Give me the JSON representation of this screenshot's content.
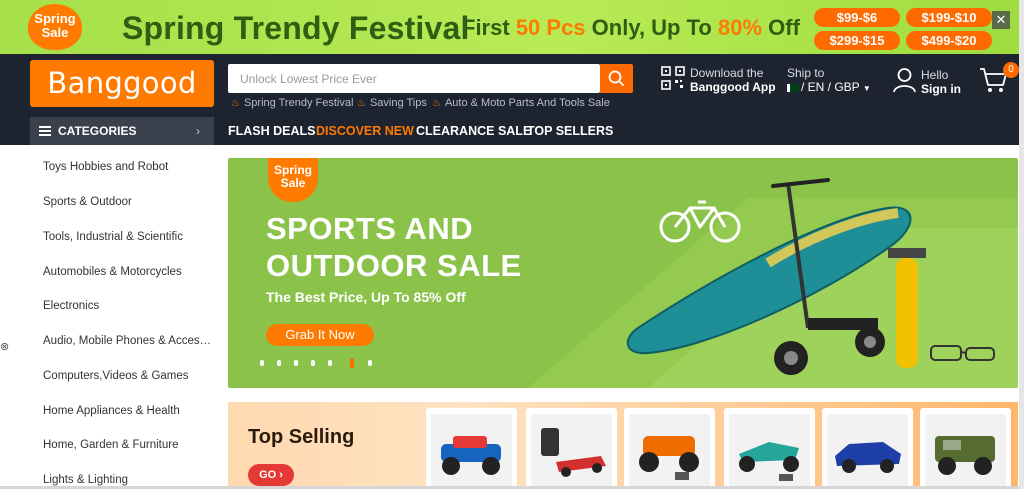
{
  "promo": {
    "sticker_line1": "Spring",
    "sticker_line2": "Sale",
    "title": "Spring Trendy Festival",
    "sub_prefix": "First",
    "sub_highlight1": "50 Pcs",
    "sub_middle": "Only, Up To",
    "sub_highlight2": "80%",
    "sub_suffix": "Off",
    "coupons": [
      "$99-$6",
      "$199-$10",
      "$299-$15",
      "$499-$20"
    ],
    "close_glyph": "✕"
  },
  "header": {
    "logo": "Banggood",
    "search_placeholder": "Unlock Lowest Price Ever",
    "hot_tags": [
      "Spring Trendy Festival",
      "Saving Tips",
      "Auto & Moto Parts And Tools Sale"
    ],
    "app_line1": "Download the",
    "app_line2": "Banggood App",
    "ship_line1": "Ship to",
    "ship_line2": "/ EN / GBP",
    "hello": "Hello",
    "sign_in": "Sign in",
    "cart_count": "0"
  },
  "nav": {
    "categories": "CATEGORIES",
    "links": [
      "FLASH DEALS",
      "DISCOVER NEW",
      "CLEARANCE SALE",
      "TOP SELLERS"
    ]
  },
  "sidebar": {
    "items": [
      "Toys Hobbies and Robot",
      "Sports & Outdoor",
      "Tools, Industrial & Scientific",
      "Automobiles & Motorcycles",
      "Electronics",
      "Audio, Mobile Phones & Accessories",
      "Computers,Videos & Games",
      "Home Appliances & Health",
      "Home, Garden & Furniture",
      "Lights & Lighting"
    ]
  },
  "hero": {
    "sticker_line1": "Spring",
    "sticker_line2": "Sale",
    "headline_line1": "SPORTS AND",
    "headline_line2": "OUTDOOR SALE",
    "subline": "The Best Price, Up To 85% Off",
    "cta": "Grab It Now",
    "slides": 7,
    "active_slide": 6
  },
  "top_selling": {
    "title": "Top Selling",
    "go": "GO ›"
  },
  "colors": {
    "brand_orange": "#ff7a00",
    "header_dark": "#1d2430",
    "promo_green": "#a6e04a",
    "hero_green": "#8bc34a"
  },
  "icons": [
    "search-icon",
    "qr-code-icon",
    "flag-icon",
    "user-icon",
    "cart-icon",
    "menu-icon",
    "chevron-right-icon",
    "flame-icon",
    "bicycle-icon",
    "close-icon"
  ]
}
